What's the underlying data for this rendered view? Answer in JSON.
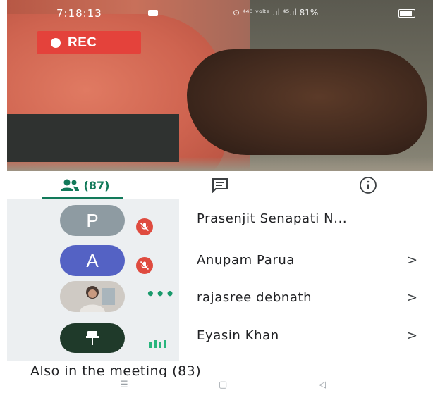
{
  "status_bar": {
    "time": "7:18:13",
    "right_indicators": "⊙ ⁴⁴⁸ ᵛᵒˡᵗᵉ .ıl ⁴⁵.ıl 81%",
    "battery_percent": 81
  },
  "recording": {
    "label": "REC",
    "color": "#e4423b"
  },
  "tabs": {
    "people_count": "(87)",
    "accent_color": "#127a5a",
    "chat_icon": "chat-icon",
    "info_icon": "info-icon"
  },
  "participants": [
    {
      "initial": "P",
      "name": "Prasenjit Senapati N...",
      "avatar_color": "#8e9ba2",
      "muted": true,
      "chevron": ""
    },
    {
      "initial": "A",
      "name": "Anupam Parua",
      "avatar_color": "#5462c4",
      "muted": true,
      "chevron": ">"
    },
    {
      "initial": "",
      "name": "rajasree debnath",
      "avatar_color": "#d9d5d0",
      "muted": false,
      "chevron": ">"
    },
    {
      "initial": "",
      "name": "Eyasin Khan",
      "avatar_color": "#1f3a2a",
      "muted": false,
      "chevron": ">"
    }
  ],
  "section": {
    "title": "Also in the meeting (83)"
  }
}
